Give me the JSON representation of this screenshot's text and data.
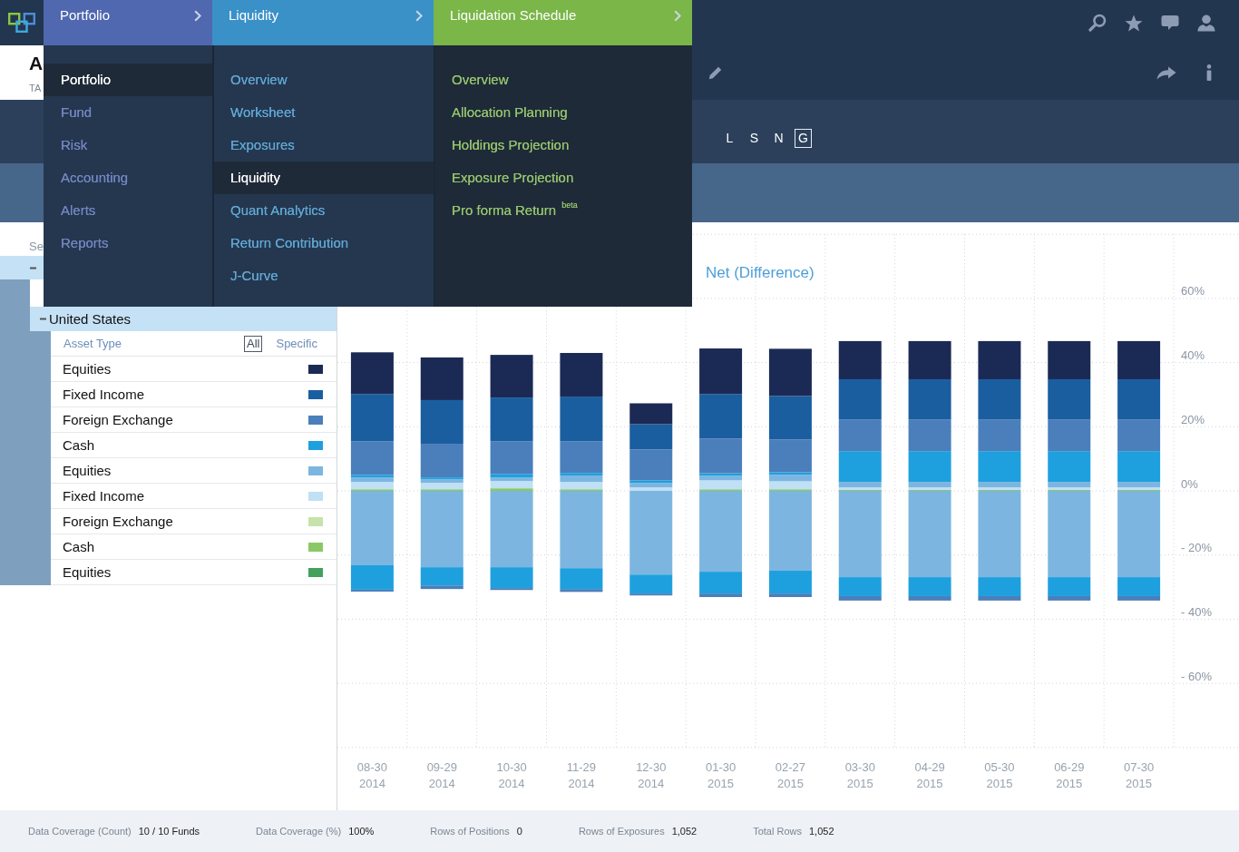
{
  "top_bar": {
    "breadcrumbs": [
      {
        "label": "Portfolio",
        "color": "#5068b0",
        "menu": [
          {
            "label": "Portfolio",
            "selected": true
          },
          {
            "label": "Fund",
            "selected": false
          },
          {
            "label": "Risk",
            "selected": false
          },
          {
            "label": "Accounting",
            "selected": false
          },
          {
            "label": "Alerts",
            "selected": false
          },
          {
            "label": "Reports",
            "selected": false
          }
        ]
      },
      {
        "label": "Liquidity",
        "color": "#3a91c8",
        "menu": [
          {
            "label": "Overview",
            "selected": false
          },
          {
            "label": "Worksheet",
            "selected": false
          },
          {
            "label": "Exposures",
            "selected": false
          },
          {
            "label": "Liquidity",
            "selected": true
          },
          {
            "label": "Quant Analytics",
            "selected": false
          },
          {
            "label": "Return Contribution",
            "selected": false
          },
          {
            "label": "J-Curve",
            "selected": false
          }
        ]
      },
      {
        "label": "Liquidation Schedule",
        "color": "#7ab648",
        "menu": [
          {
            "label": "Overview",
            "selected": false
          },
          {
            "label": "Allocation Planning",
            "selected": false
          },
          {
            "label": "Holdings Projection",
            "selected": false
          },
          {
            "label": "Exposure Projection",
            "selected": false
          },
          {
            "label": "Pro forma Return $^{beta}$",
            "selected": false
          }
        ]
      }
    ]
  },
  "page_header": {
    "title": "A",
    "subtitle": "TA"
  },
  "view_toggle": [
    {
      "label": "L",
      "selected": false
    },
    {
      "label": "S",
      "selected": false
    },
    {
      "label": "N",
      "selected": false
    },
    {
      "label": "G",
      "selected": true
    }
  ],
  "tree": {
    "header": "Se",
    "nodes": [
      {
        "expanded": true,
        "children": [
          {
            "label": "United States",
            "expanded": true
          }
        ]
      }
    ]
  },
  "asset_table": {
    "header": "Asset Type",
    "filters": [
      {
        "label": "All",
        "selected": true
      },
      {
        "label": "Specific",
        "selected": false
      }
    ],
    "rows": [
      {
        "label": "Equities",
        "color": "#1b2a55"
      },
      {
        "label": "Fixed Income",
        "color": "#1a5ea0"
      },
      {
        "label": "Foreign Exchange",
        "color": "#4a7fbb"
      },
      {
        "label": "Cash",
        "color": "#1fa0de"
      },
      {
        "label": "Equities",
        "color": "#7cb6e0"
      },
      {
        "label": "Fixed Income",
        "color": "#bfe0f5"
      },
      {
        "label": "Foreign Exchange",
        "color": "#c6e3ab"
      },
      {
        "label": "Cash",
        "color": "#8bc865"
      },
      {
        "label": "Equities",
        "color": "#44a05c"
      }
    ]
  },
  "chart": {
    "chart_data": {
      "type": "bar",
      "title": "Net (Difference)",
      "stacked": true,
      "grid": true,
      "categories": [
        "08-30\n2014",
        "09-29\n2014",
        "10-30\n2014",
        "11-29\n2014",
        "12-30\n2014",
        "01-30\n2015",
        "02-27\n2015",
        "03-30\n2015",
        "04-29\n2015",
        "05-30\n2015",
        "06-29\n2015",
        "07-30\n2015"
      ],
      "series": [
        {
          "color": "#8bc865",
          "values": [
            0.5,
            0.5,
            0.8,
            0.5,
            0,
            0.5,
            0.5,
            0.3,
            0.3,
            0.3,
            0.3,
            0.3
          ]
        },
        {
          "color": "#bfe0f5",
          "values": [
            2.3,
            2.0,
            2.3,
            2.3,
            1.1,
            2.8,
            2.5,
            0.8,
            0.8,
            0.8,
            0.8,
            0.8
          ]
        },
        {
          "color": "#7cb6e0",
          "values": [
            1.4,
            1.1,
            1.1,
            2.0,
            1.4,
            1.4,
            2.0,
            1.7,
            1.7,
            1.7,
            1.7,
            1.7
          ]
        },
        {
          "color": "#1fa0de",
          "values": [
            0.8,
            0.6,
            1.1,
            0.8,
            0.8,
            0.8,
            0.8,
            9.6,
            9.6,
            9.6,
            9.6,
            9.6
          ]
        },
        {
          "color": "#4a7fbb",
          "values": [
            10.5,
            10.5,
            10.2,
            9.9,
            9.6,
            10.8,
            10.2,
            9.9,
            9.9,
            9.9,
            9.9,
            9.9
          ]
        },
        {
          "color": "#1a5ea0",
          "values": [
            14.7,
            13.6,
            13.6,
            13.9,
            7.9,
            13.9,
            13.6,
            12.5,
            12.5,
            12.5,
            12.5,
            12.5
          ]
        },
        {
          "color": "#1b2a55",
          "values": [
            13.0,
            13.3,
            13.3,
            13.6,
            6.5,
            14.2,
            14.7,
            11.9,
            11.9,
            11.9,
            11.9,
            11.9
          ]
        },
        {
          "color": "#7cb6e0",
          "values": [
            -23.2,
            -23.8,
            -23.8,
            -24.1,
            -26.1,
            -25.2,
            -24.9,
            -26.9,
            -26.9,
            -26.9,
            -26.9,
            -26.9
          ]
        },
        {
          "color": "#1fa0de",
          "values": [
            -7.6,
            -5.7,
            -6.5,
            -6.5,
            -5.9,
            -6.8,
            -7.1,
            -5.9,
            -5.9,
            -5.9,
            -5.9,
            -5.9
          ]
        },
        {
          "color": "#4a7fbb",
          "values": [
            -0.6,
            -1.1,
            -0.6,
            -0.9,
            -0.6,
            -1.1,
            -1.1,
            -1.4,
            -1.4,
            -1.4,
            -1.4,
            -1.4
          ]
        }
      ],
      "ylim": [
        -80,
        80
      ],
      "yticks": [
        {
          "value": 60,
          "label": "60%"
        },
        {
          "value": 40,
          "label": "40%"
        },
        {
          "value": 20,
          "label": "20%"
        },
        {
          "value": 0,
          "label": "0%"
        },
        {
          "value": -20,
          "label": "- 20%"
        },
        {
          "value": -40,
          "label": "- 40%"
        },
        {
          "value": -60,
          "label": "- 60%"
        }
      ]
    }
  },
  "status_bar": [
    {
      "label": "Data Coverage (Count)",
      "value": "10 / 10 Funds"
    },
    {
      "label": "Data Coverage (%)",
      "value": "100%"
    },
    {
      "label": "Rows of Positions",
      "value": "0"
    },
    {
      "label": "Rows of Exposures",
      "value": "1,052"
    },
    {
      "label": "Total Rows",
      "value": "1,052"
    }
  ]
}
